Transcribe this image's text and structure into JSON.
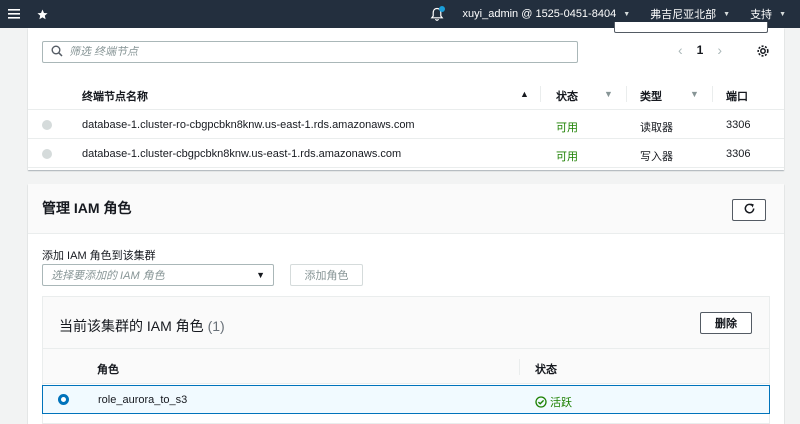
{
  "topnav": {
    "user": "xuyi_admin @ 1525-0451-8404",
    "region": "弗吉尼亚北部",
    "support": "支持"
  },
  "endpoints": {
    "search_placeholder": "筛选 终端节点",
    "page": "1",
    "columns": {
      "name": "终端节点名称",
      "status": "状态",
      "type": "类型",
      "port": "端口"
    },
    "rows": [
      {
        "name": "database-1.cluster-ro-cbgpcbkn8knw.us-east-1.rds.amazonaws.com",
        "status": "可用",
        "type": "读取器",
        "port": "3306"
      },
      {
        "name": "database-1.cluster-cbgpcbkn8knw.us-east-1.rds.amazonaws.com",
        "status": "可用",
        "type": "写入器",
        "port": "3306"
      }
    ]
  },
  "iam": {
    "title": "管理 IAM 角色",
    "add_label": "添加 IAM 角色到该集群",
    "select_placeholder": "选择要添加的 IAM 角色",
    "add_button": "添加角色",
    "current_title": "当前该集群的 IAM 角色",
    "current_count": "(1)",
    "delete_button": "删除",
    "columns": {
      "role": "角色",
      "status": "状态"
    },
    "rows": [
      {
        "role": "role_aurora_to_s3",
        "status": "活跃"
      }
    ]
  },
  "colors": {
    "nav_bg": "#232f3e",
    "success": "#1d8102",
    "selected": "#0073bb"
  }
}
